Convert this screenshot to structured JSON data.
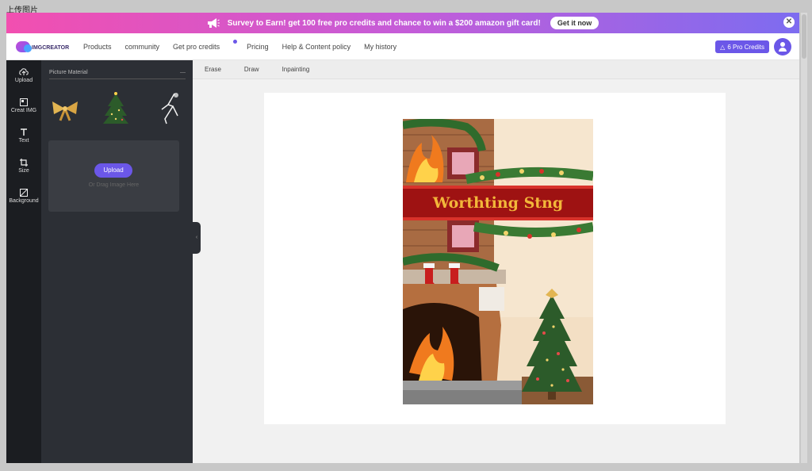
{
  "window": {
    "title": "上传图片"
  },
  "promo": {
    "message": "Survey to Earn! get 100 free pro credits and chance to win a $200 amazon gift card!",
    "button": "Get it now",
    "close": "✕"
  },
  "nav": {
    "logo": "IMGCREATOR",
    "items": [
      "Products",
      "community",
      "Get pro credits",
      "Pricing",
      "Help & Content policy",
      "My history"
    ],
    "credits": "6 Pro Credits"
  },
  "toolbar": {
    "items": [
      {
        "label": "Upload",
        "icon": "cloud-upload-icon"
      },
      {
        "label": "Creat IMG",
        "icon": "image-icon"
      },
      {
        "label": "Text",
        "icon": "text-icon"
      },
      {
        "label": "Size",
        "icon": "crop-icon"
      },
      {
        "label": "Background",
        "icon": "background-icon"
      }
    ]
  },
  "panel": {
    "header": "Picture Material",
    "upload_button": "Upload",
    "upload_hint": "Or Drag  Image Here"
  },
  "editor": {
    "tabs": [
      "Erase",
      "Draw",
      "Inpainting"
    ]
  },
  "artwork": {
    "banner_text": "Worthting Stng"
  },
  "colors": {
    "accent": "#6b57e8",
    "sidebar": "#1b1d21",
    "panel": "#2c2f35"
  }
}
